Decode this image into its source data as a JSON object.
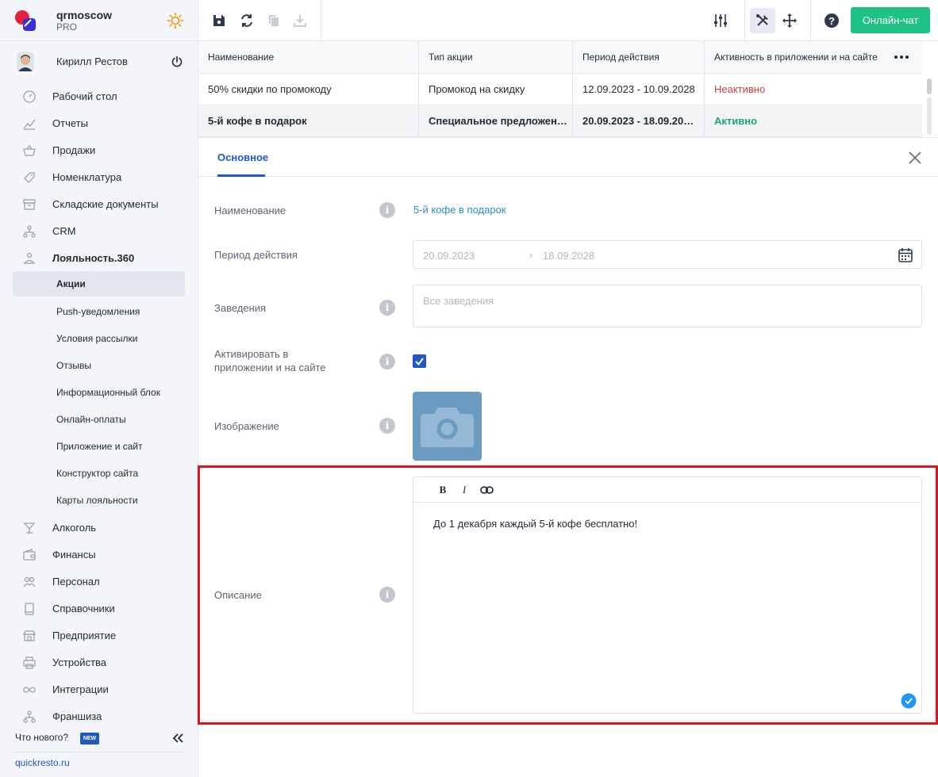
{
  "brand": {
    "name": "qrmoscow",
    "plan": "PRO"
  },
  "user": {
    "name": "Кирилл Рестов"
  },
  "nav": {
    "items": [
      {
        "label": "Рабочий стол",
        "icon": "gauge-icon"
      },
      {
        "label": "Отчеты",
        "icon": "chart-icon"
      },
      {
        "label": "Продажи",
        "icon": "basket-icon"
      },
      {
        "label": "Номенклатура",
        "icon": "tag-icon"
      },
      {
        "label": "Складские документы",
        "icon": "archive-icon"
      },
      {
        "label": "CRM",
        "icon": "hierarchy-icon"
      },
      {
        "label": "Лояльность.360",
        "icon": "loyalty-icon"
      }
    ],
    "sub_items": [
      {
        "label": "Акции",
        "active": true
      },
      {
        "label": "Push-уведомления"
      },
      {
        "label": "Условия рассылки"
      },
      {
        "label": "Отзывы"
      },
      {
        "label": "Информационный блок"
      },
      {
        "label": "Онлайн-оплаты"
      },
      {
        "label": "Приложение и сайт"
      },
      {
        "label": "Конструктор сайта"
      },
      {
        "label": "Карты лояльности"
      }
    ],
    "items_after": [
      {
        "label": "Алкоголь",
        "icon": "glass-icon"
      },
      {
        "label": "Финансы",
        "icon": "wallet-icon"
      },
      {
        "label": "Персонал",
        "icon": "people-icon"
      },
      {
        "label": "Справочники",
        "icon": "book-icon"
      },
      {
        "label": "Предприятие",
        "icon": "store-icon"
      },
      {
        "label": "Устройства",
        "icon": "printer-icon"
      },
      {
        "label": "Интеграции",
        "icon": "infinity-icon"
      },
      {
        "label": "Франшиза",
        "icon": "hierarchy-icon"
      }
    ]
  },
  "footer": {
    "whats_new": "Что нового?",
    "new_badge": "NEW",
    "site_link": "quickresto.ru"
  },
  "toolbar": {
    "chat_label": "Онлайн-чат"
  },
  "table": {
    "headers": [
      "Наименование",
      "Тип акции",
      "Период действия",
      "Активность в приложении и на сайте"
    ],
    "rows": [
      {
        "name": "50% скидки по промокоду",
        "type": "Промокод на скидку",
        "period": "12.09.2023 - 10.09.2028",
        "status": "Неактивно"
      },
      {
        "name": "5-й кофе в подарок",
        "type": "Специальное предложен…",
        "period": "20.09.2023 - 18.09.20…",
        "status": "Активно"
      }
    ]
  },
  "detail": {
    "tab": "Основное",
    "fields": {
      "name_label": "Наименование",
      "name_value": "5-й кофе в подарок",
      "period_label": "Период действия",
      "period_from": "20.09.2023",
      "period_to": "18.09.2028",
      "venues_label": "Заведения",
      "venues_placeholder": "Все заведения",
      "activate_label": "Активировать в приложении и на сайте",
      "activate_checked": true,
      "image_label": "Изображение",
      "description_label": "Описание",
      "description_text": "До 1 декабря каждый 5-й кофе бесплатно!"
    },
    "editor": {
      "bold": "B",
      "italic": "I"
    }
  },
  "colors": {
    "accent": "#1f58c7",
    "chat": "#1fc285",
    "active": "#1aa86b",
    "inactive": "#d13f3f",
    "highlight": "#e0141a"
  }
}
